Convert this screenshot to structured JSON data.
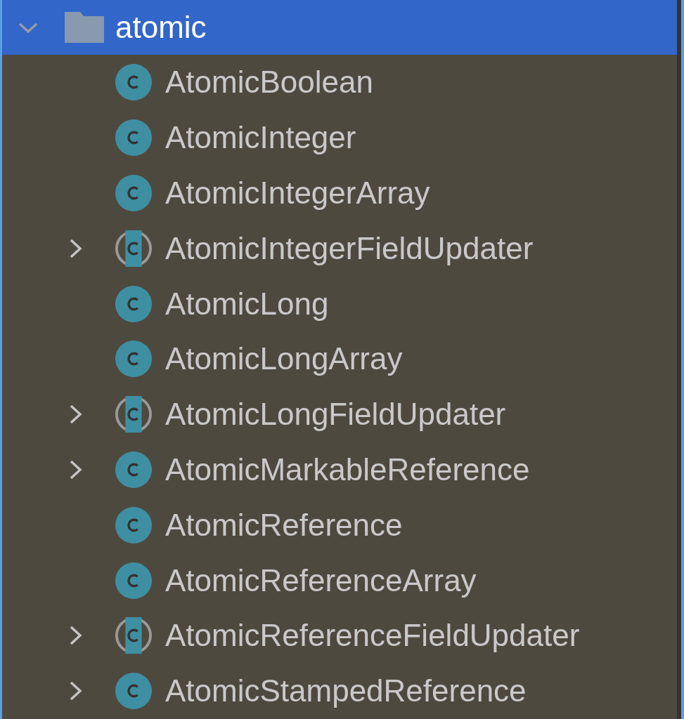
{
  "folder": {
    "name": "atomic",
    "expanded": true,
    "selected": true,
    "children": [
      {
        "name": "AtomicBoolean",
        "kind": "class",
        "expandable": false
      },
      {
        "name": "AtomicInteger",
        "kind": "class",
        "expandable": false
      },
      {
        "name": "AtomicIntegerArray",
        "kind": "class",
        "expandable": false
      },
      {
        "name": "AtomicIntegerFieldUpdater",
        "kind": "abstract",
        "expandable": true
      },
      {
        "name": "AtomicLong",
        "kind": "class",
        "expandable": false
      },
      {
        "name": "AtomicLongArray",
        "kind": "class",
        "expandable": false
      },
      {
        "name": "AtomicLongFieldUpdater",
        "kind": "abstract",
        "expandable": true
      },
      {
        "name": "AtomicMarkableReference",
        "kind": "class",
        "expandable": true
      },
      {
        "name": "AtomicReference",
        "kind": "class",
        "expandable": false
      },
      {
        "name": "AtomicReferenceArray",
        "kind": "class",
        "expandable": false
      },
      {
        "name": "AtomicReferenceFieldUpdater",
        "kind": "abstract",
        "expandable": true
      },
      {
        "name": "AtomicStampedReference",
        "kind": "class",
        "expandable": true
      }
    ]
  }
}
